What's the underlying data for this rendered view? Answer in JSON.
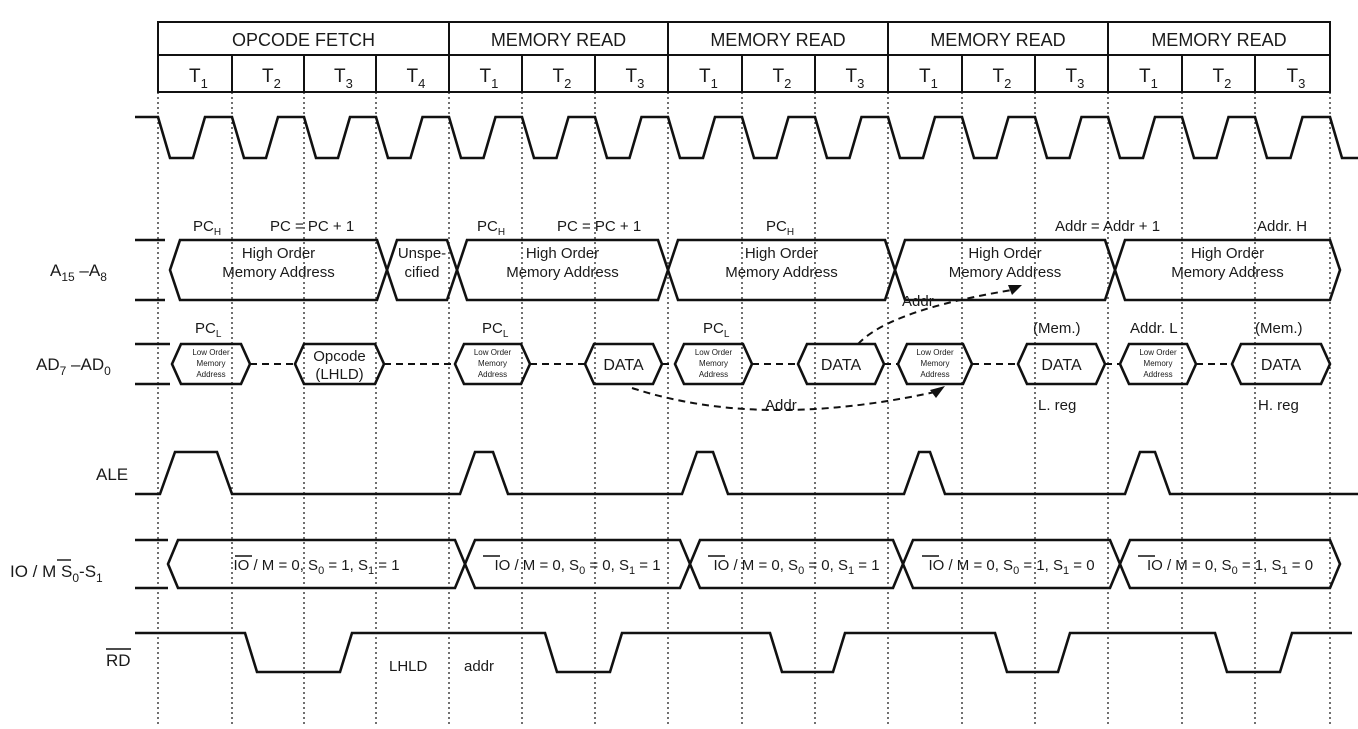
{
  "machine_cycles": [
    {
      "label": "OPCODE FETCH",
      "states": [
        "T1",
        "T2",
        "T3",
        "T4"
      ]
    },
    {
      "label": "MEMORY READ",
      "states": [
        "T1",
        "T2",
        "T3"
      ]
    },
    {
      "label": "MEMORY READ",
      "states": [
        "T1",
        "T2",
        "T3"
      ]
    },
    {
      "label": "MEMORY READ",
      "states": [
        "T1",
        "T2",
        "T3"
      ]
    },
    {
      "label": "MEMORY READ",
      "states": [
        "T1",
        "T2",
        "T3"
      ]
    }
  ],
  "signals": {
    "clock": {
      "name": ""
    },
    "address_high": {
      "name_main": "A",
      "sub1": "15",
      "dash": " –A",
      "sub2": "8"
    },
    "address_data": {
      "name_main": "AD",
      "sub1": "7",
      "dash": " –AD",
      "sub2": "0"
    },
    "ale": {
      "name": "ALE"
    },
    "status": {
      "name": "IO / M  S0-S1"
    },
    "rd": {
      "name": "RD"
    }
  },
  "address_high_segments": [
    {
      "line1": "High Order",
      "line2": "Memory Address"
    },
    {
      "line1": "Unspe-",
      "line2": "cified"
    },
    {
      "line1": "High Order",
      "line2": "Memory Address"
    },
    {
      "line1": "High Order",
      "line2": "Memory Address"
    },
    {
      "line1": "High Order",
      "line2": "Memory Address"
    },
    {
      "line1": "High Order",
      "line2": "Memory Address"
    }
  ],
  "address_high_annotations": [
    {
      "text": "PC",
      "sub": "H"
    },
    {
      "text": "PC = PC + 1",
      "sub": ""
    },
    {
      "text": "PC",
      "sub": "H"
    },
    {
      "text": "PC = PC + 1",
      "sub": ""
    },
    {
      "text": "PC",
      "sub": "H"
    },
    {
      "text": "Addr = Addr + 1",
      "sub": ""
    },
    {
      "text": "Addr. H",
      "sub": ""
    }
  ],
  "ad_segments": [
    {
      "type": "addr",
      "lines": [
        "Low Order",
        "Memory",
        "Address"
      ]
    },
    {
      "type": "data",
      "lines": [
        "Opcode",
        "(LHLD)"
      ]
    },
    {
      "type": "addr",
      "lines": [
        "Low Order",
        "Memory",
        "Address"
      ]
    },
    {
      "type": "data",
      "lines": [
        "DATA"
      ]
    },
    {
      "type": "addr",
      "lines": [
        "Low Order",
        "Memory",
        "Address"
      ]
    },
    {
      "type": "data",
      "lines": [
        "DATA"
      ]
    },
    {
      "type": "addr",
      "lines": [
        "Low Order",
        "Memory",
        "Address"
      ]
    },
    {
      "type": "data",
      "lines": [
        "DATA"
      ]
    },
    {
      "type": "addr",
      "lines": [
        "Low Order",
        "Memory",
        "Address"
      ]
    },
    {
      "type": "data",
      "lines": [
        "DATA"
      ]
    }
  ],
  "ad_annotations": {
    "pcl": {
      "text": "PC",
      "sub": "L"
    },
    "mem": "(Mem.)",
    "addr_l": "Addr. L",
    "l_reg": "L. reg",
    "h_reg": "H. reg",
    "addr": "Addr"
  },
  "status_segments": [
    "IO / M = 0, S0 = 1, S1 = 1",
    "IO / M = 0, S0 = 0, S1 = 1",
    "IO / M = 0, S0 = 0, S1 = 1",
    "IO / M = 0, S0 = 1, S1 = 0",
    "IO / M = 0, S0 = 1, S1 = 0"
  ],
  "status_segments_parts": [
    {
      "io": "0",
      "s0": "1",
      "s1": "1"
    },
    {
      "io": "0",
      "s0": "0",
      "s1": "1"
    },
    {
      "io": "0",
      "s0": "0",
      "s1": "1"
    },
    {
      "io": "0",
      "s0": "1",
      "s1": "0"
    },
    {
      "io": "0",
      "s0": "1",
      "s1": "0"
    }
  ],
  "rd_annotations": {
    "lhld": "LHLD",
    "addr": "addr"
  }
}
